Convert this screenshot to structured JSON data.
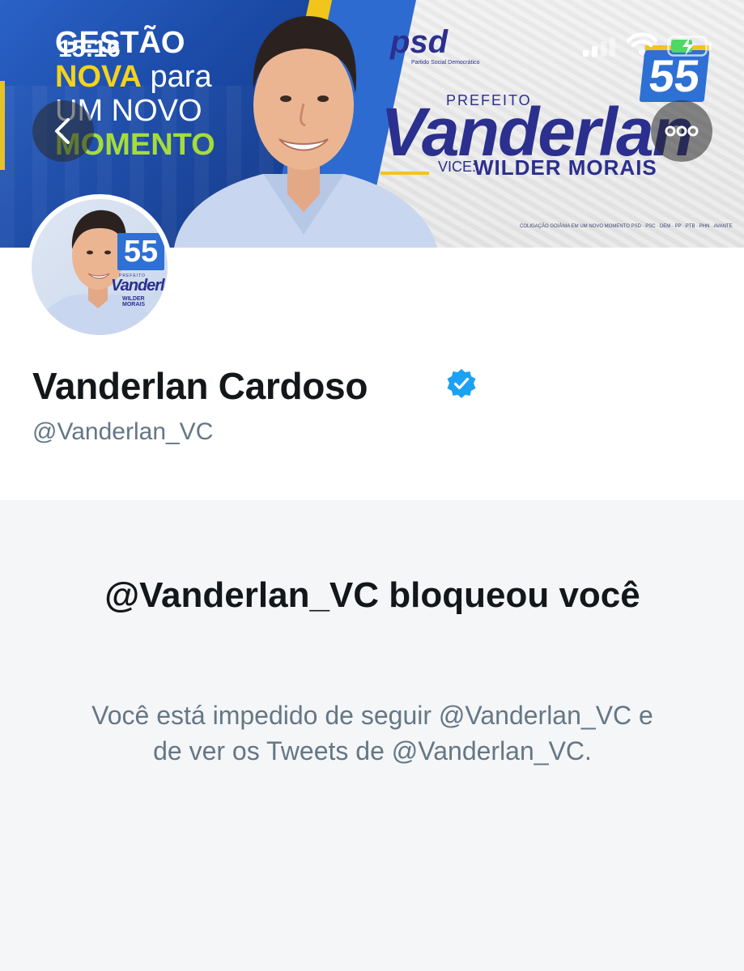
{
  "status_bar": {
    "time": "15:16"
  },
  "banner": {
    "slogan_line1": "GESTÃO",
    "slogan_line2_a": "NOVA",
    "slogan_line2_b": "para",
    "slogan_line3": "UM NOVO",
    "slogan_line4": "MOMENTO",
    "party": "psd",
    "party_sub": "Partido Social Democrático",
    "number": "55",
    "prefeito": "PREFEITO",
    "candidate": "Vanderlan",
    "vice_label": "VICE:",
    "vice_name": "WILDER MORAIS",
    "coalition": "COLIGAÇÃO GOIÂNIA EM UM NOVO MOMENTO  PSD · PSC · DEM · PP · PTB · PHN · AVANTE"
  },
  "avatar": {
    "number": "55",
    "prefeito": "PREFEITO",
    "name": "Vanderlan",
    "sub": "WILDER MORAIS"
  },
  "profile": {
    "display_name": "Vanderlan Cardoso",
    "handle": "@Vanderlan_VC",
    "verified": true
  },
  "blocked": {
    "title": "@Vanderlan_VC bloqueou você",
    "description": "Você está impedido de seguir @Vanderlan_VC e de ver os Tweets de @Vanderlan_VC."
  },
  "colors": {
    "accent_blue": "#1da1f2",
    "text_primary": "#14171a",
    "text_secondary": "#657786",
    "background": "#f5f6f8"
  },
  "icons": [
    "back-chevron-icon",
    "more-dots-icon",
    "cellular-signal-icon",
    "wifi-icon",
    "battery-charging-icon",
    "verified-badge-icon"
  ]
}
